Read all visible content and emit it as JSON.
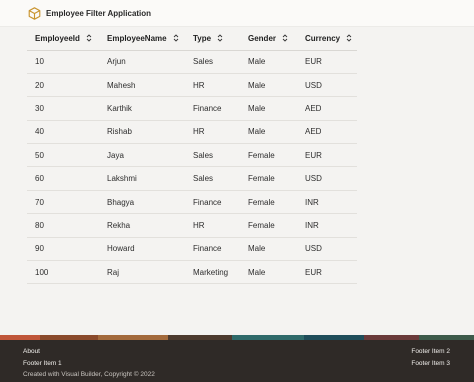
{
  "header": {
    "title": "Employee Filter Application",
    "icon": "box-icon"
  },
  "table": {
    "columns": [
      "EmployeeId",
      "EmployeeName",
      "Type",
      "Gender",
      "Currency"
    ],
    "rows": [
      [
        "10",
        "Arjun",
        "Sales",
        "Male",
        "EUR"
      ],
      [
        "20",
        "Mahesh",
        "HR",
        "Male",
        "USD"
      ],
      [
        "30",
        "Karthik",
        "Finance",
        "Male",
        "AED"
      ],
      [
        "40",
        "Rishab",
        "HR",
        "Male",
        "AED"
      ],
      [
        "50",
        "Jaya",
        "Sales",
        "Female",
        "EUR"
      ],
      [
        "60",
        "Lakshmi",
        "Sales",
        "Female",
        "USD"
      ],
      [
        "70",
        "Bhagya",
        "Finance",
        "Female",
        "INR"
      ],
      [
        "80",
        "Rekha",
        "HR",
        "Female",
        "INR"
      ],
      [
        "90",
        "Howard",
        "Finance",
        "Male",
        "USD"
      ],
      [
        "100",
        "Raj",
        "Marketing",
        "Male",
        "EUR"
      ]
    ]
  },
  "footer": {
    "about": "About",
    "item1": "Footer Item 1",
    "copyright": "Created with Visual Builder, Copyright © 2022",
    "item2": "Footer Item 2",
    "item3": "Footer Item 3"
  },
  "colors": {
    "accent": "#c9942e",
    "footer_bg": "#2f2a27",
    "band": [
      "#c0563a",
      "#8a4a2c",
      "#a36a3c",
      "#4c3a2e",
      "#2f6a6a",
      "#1f4d5a",
      "#6a3a3a",
      "#3d5a4a"
    ]
  }
}
